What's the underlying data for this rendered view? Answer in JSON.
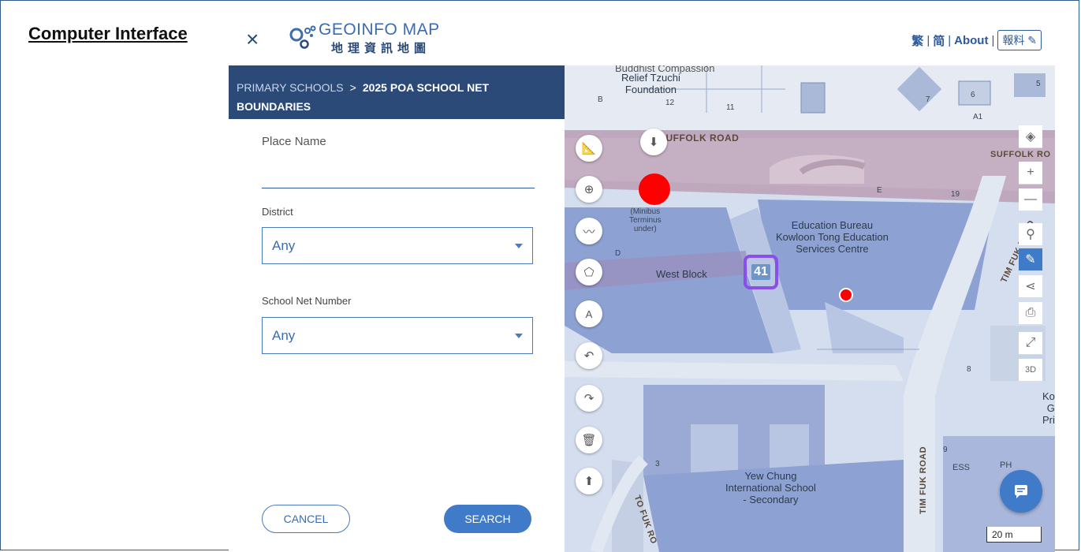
{
  "caption": "Computer Interface",
  "header": {
    "close_symbol": "×",
    "logo_title": "GEOINFO MAP",
    "logo_subtitle": "地理資訊地圖",
    "lang_trad": "繁",
    "lang_simp": "简",
    "about": "About",
    "report": "報料",
    "separator": "|"
  },
  "panel": {
    "breadcrumb_parent": "PRIMARY SCHOOLS",
    "breadcrumb_sep": ">",
    "breadcrumb_current": "2025 POA SCHOOL NET BOUNDARIES",
    "place_name_label": "Place Name",
    "place_name_value": "",
    "district_label": "District",
    "district_value": "Any",
    "school_net_label": "School Net Number",
    "school_net_value": "Any",
    "cancel_label": "CANCEL",
    "search_label": "SEARCH"
  },
  "map": {
    "labels": {
      "tzuchi": "Relief Tzuchi\nFoundation",
      "buddhist": "Buddhist Compassion",
      "suffolk1": "SUFFOLK ROAD",
      "suffolk2": "SUFFOLK RO",
      "minibus": "(Minibus\nTerminus\nunder)",
      "edb": "Education Bureau\nKowloon Tong Education\nServices Centre",
      "west_block": "West Block",
      "tim_fuk1": "TIM FUK ROAD",
      "tim_fuk2": "TIM FUK ROAD",
      "to_fuk": "TO FUK RO",
      "yew_chung": "Yew Chung\nInternational School\n- Secondary",
      "ess": "ESS",
      "ph": "PH",
      "ko": "Ko\nG\nPri",
      "n12": "12",
      "n11": "11",
      "n5": "5",
      "n6": "6",
      "n7": "7",
      "n19": "19",
      "nB": "B",
      "nA1": "A1",
      "nE": "E",
      "nD": "D",
      "n8": "8",
      "n3": "3",
      "n9": "9"
    },
    "net_badge": "41",
    "scale": "20 m"
  },
  "colors": {
    "header_bg": "#2c4a78",
    "accent": "#3f7bc8",
    "marker": "#ff0000",
    "badge_border": "#8a4fe8"
  },
  "icons": {
    "tools_left": [
      "ruler-icon",
      "locate-icon",
      "polyline-icon",
      "polygon-icon",
      "text-size-icon",
      "undo-icon",
      "redo-icon",
      "trash-icon",
      "upload-icon",
      "download-icon"
    ],
    "tools_right": [
      "layers-icon",
      "zoom-in-icon",
      "zoom-out-icon",
      "pin-icon",
      "pencil-icon",
      "share-icon",
      "print-icon",
      "fullscreen-icon",
      "3d-icon"
    ]
  }
}
